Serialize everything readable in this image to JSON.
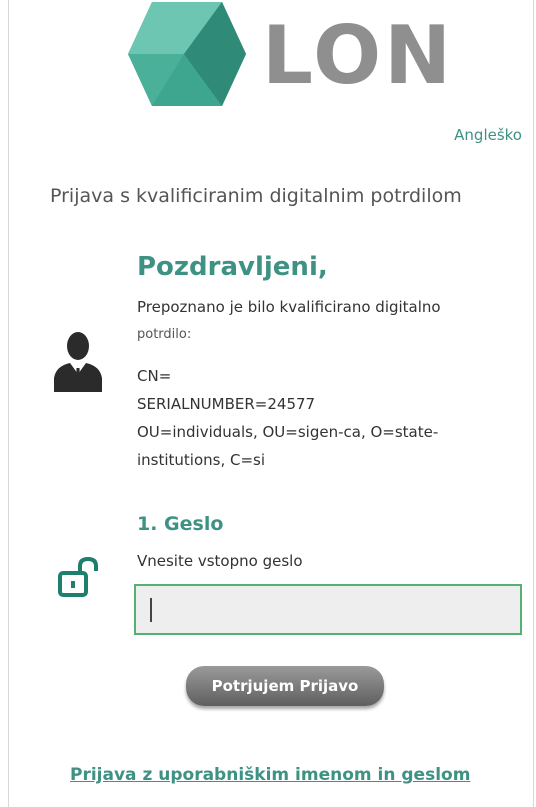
{
  "header": {
    "logo_text": "LON",
    "language_link": "Angleško"
  },
  "page_title": "Prijava s kvalificiranim digitalnim potrdilom",
  "certificate": {
    "greeting": "Pozdravljeni,",
    "detected_line1": "Prepoznano je bilo kvalificirano digitalno",
    "detected_line2": "potrdilo:",
    "cn": "CN=",
    "serial": "SERIALNUMBER=24577",
    "ou_line1": "OU=individuals, OU=sigen-ca, O=state-",
    "ou_line2": "institutions, C=si"
  },
  "step": {
    "title": "1. Geslo",
    "label": "Vnesite vstopno geslo",
    "input_value": ""
  },
  "actions": {
    "confirm_label": "Potrjujem Prijavo",
    "alt_login_label": "Prijava z uporabniškim imenom in geslom"
  },
  "colors": {
    "accent": "#3e9283",
    "input_border": "#55b073",
    "logo_gray": "#8f8f8f"
  },
  "icons": {
    "avatar": "user-silhouette-icon",
    "lock": "unlock-icon"
  }
}
